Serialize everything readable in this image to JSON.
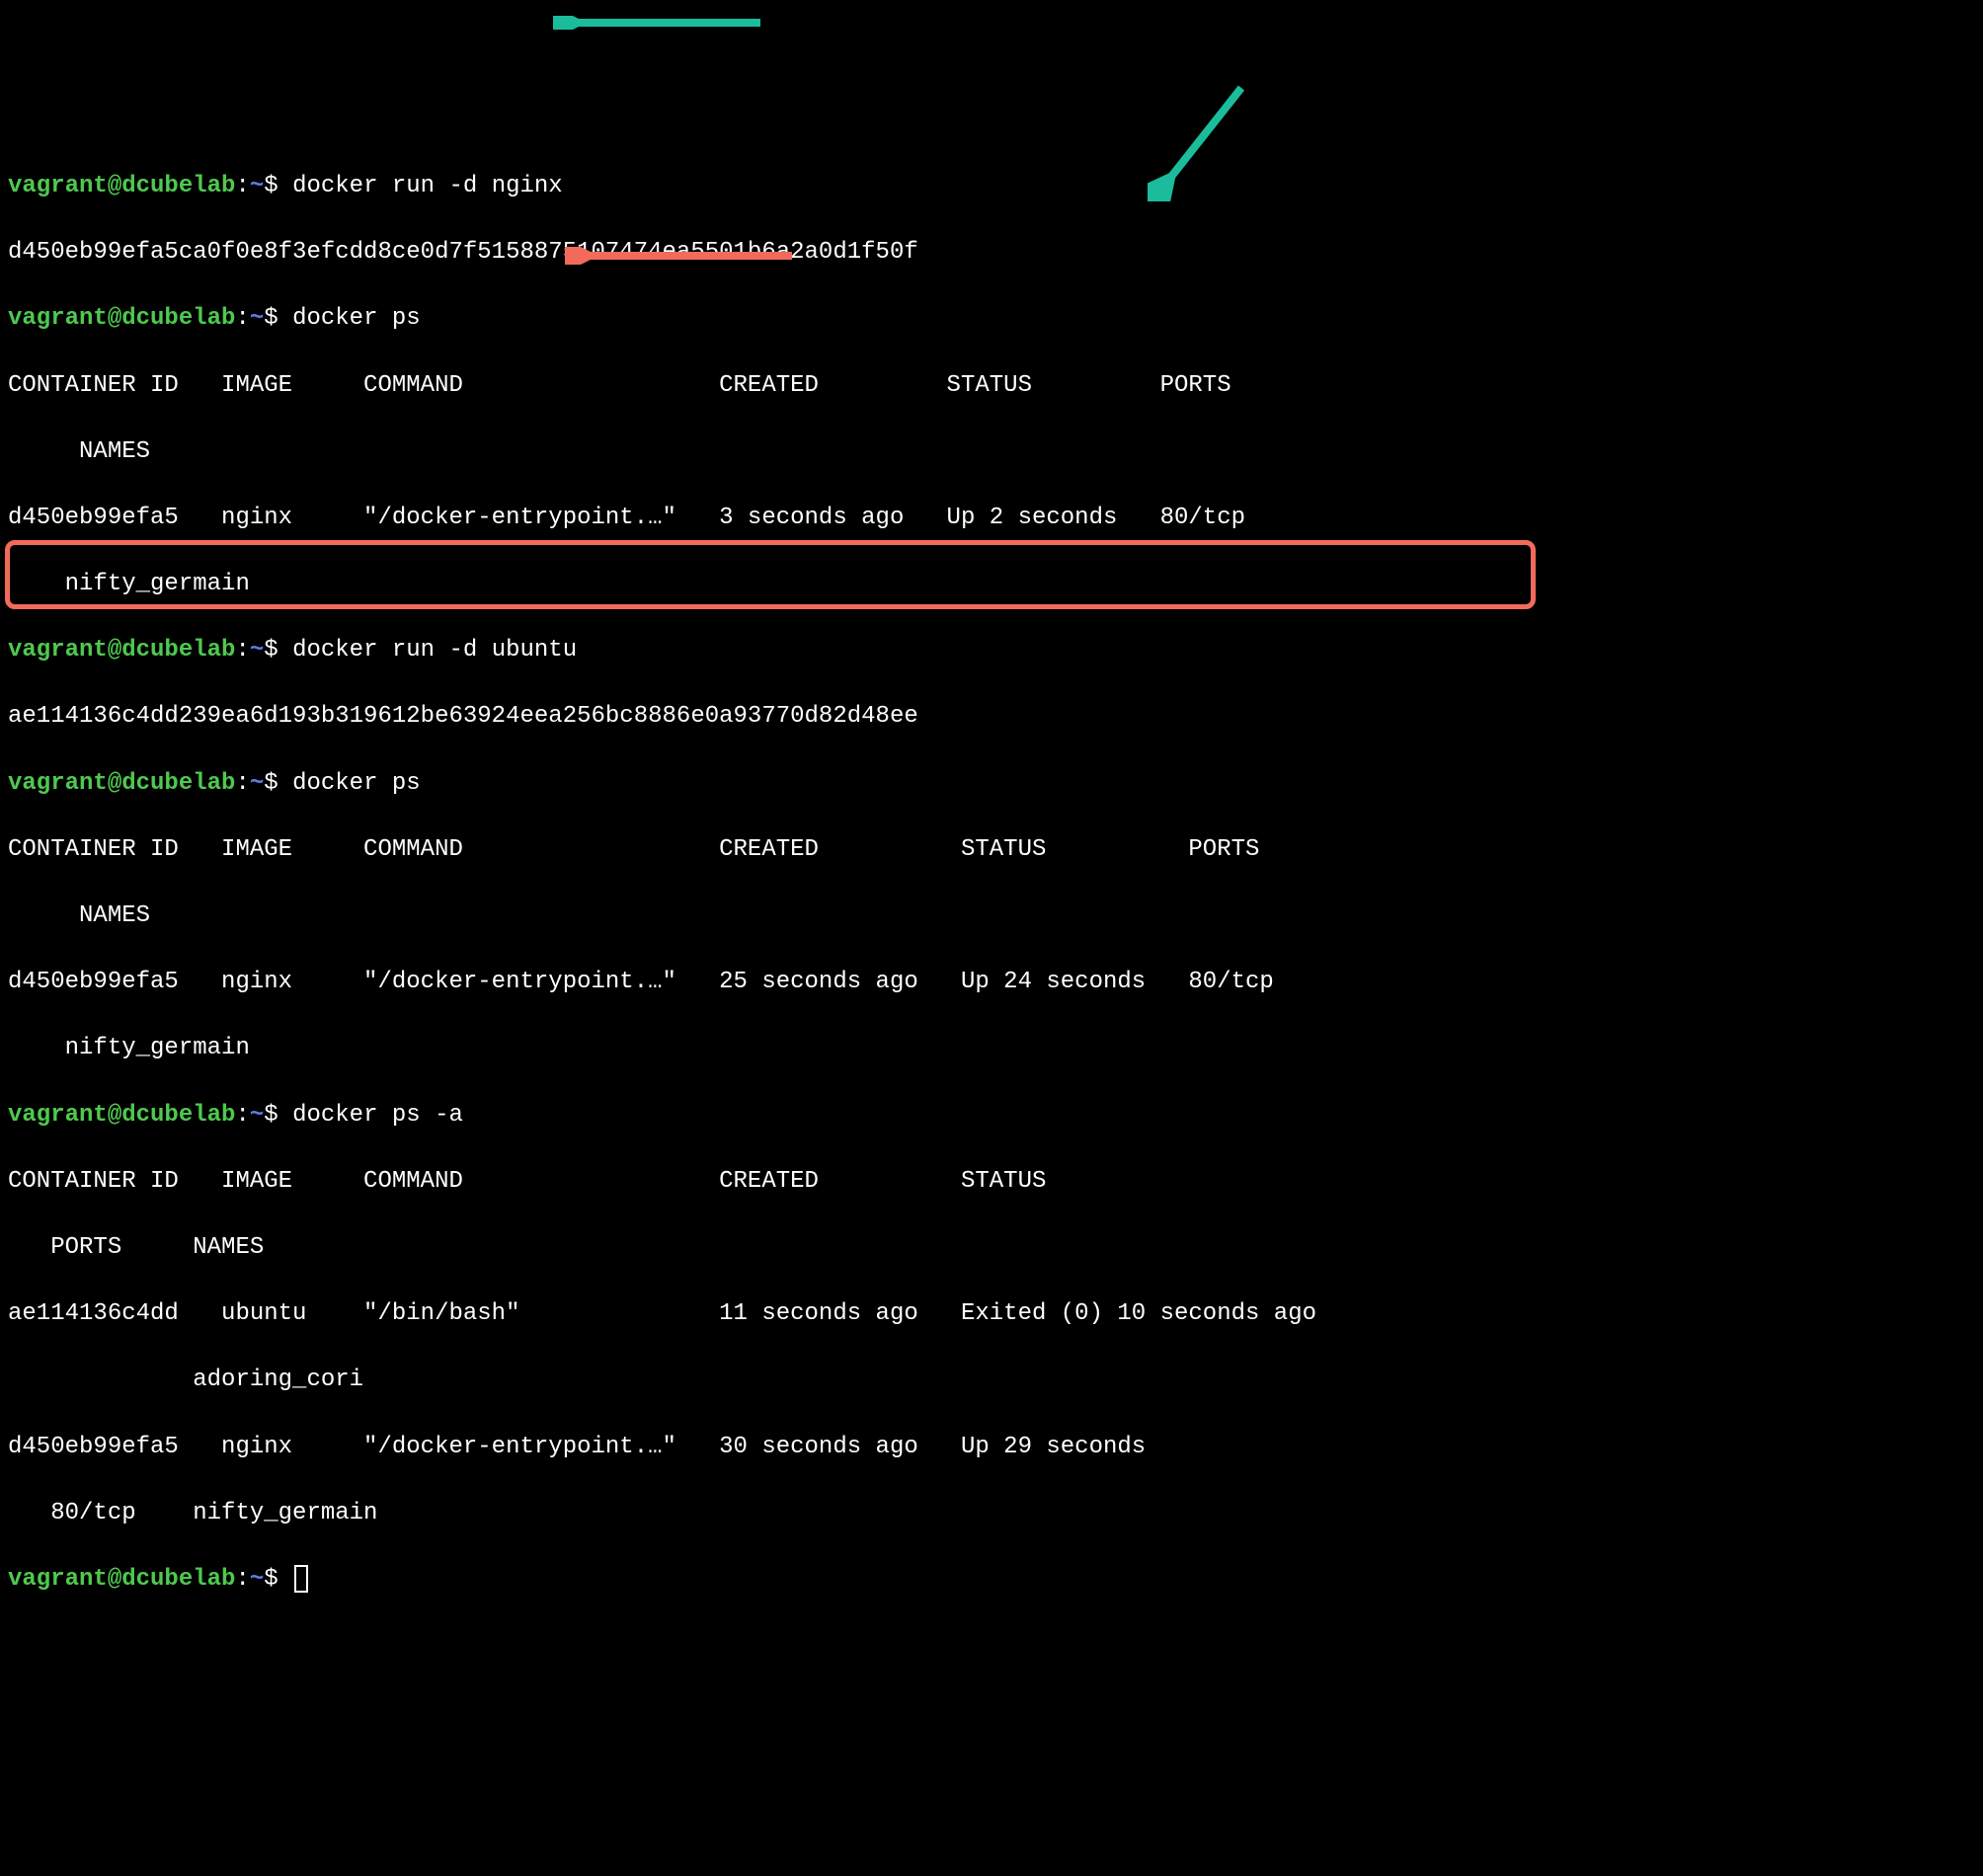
{
  "prompt": {
    "user": "vagrant@dcubelab",
    "colon": ":",
    "path": "~",
    "dollar": "$"
  },
  "cmd1": "docker run -d nginx",
  "out1": "d450eb99efa5ca0f0e8f3efcdd8ce0d7f5158875107474ea5501b6a2a0d1f50f",
  "cmd2": "docker ps",
  "ps1": {
    "hdr1": "CONTAINER ID   IMAGE     COMMAND                  CREATED         STATUS         PORTS",
    "hdr2": "     NAMES",
    "row1": "d450eb99efa5   nginx     \"/docker-entrypoint.…\"   3 seconds ago   Up 2 seconds   80/tcp",
    "row2": "    nifty_germain"
  },
  "cmd3": "docker run -d ubuntu",
  "out3": "ae114136c4dd239ea6d193b319612be63924eea256bc8886e0a93770d82d48ee",
  "cmd4": "docker ps",
  "ps2": {
    "hdr1": "CONTAINER ID   IMAGE     COMMAND                  CREATED          STATUS          PORTS",
    "hdr2": "     NAMES",
    "row1": "d450eb99efa5   nginx     \"/docker-entrypoint.…\"   25 seconds ago   Up 24 seconds   80/tcp",
    "row2": "    nifty_germain"
  },
  "cmd5": "docker ps -a",
  "ps3": {
    "hdr1": "CONTAINER ID   IMAGE     COMMAND                  CREATED          STATUS",
    "hdr2": "   PORTS     NAMES",
    "row1": "ae114136c4dd   ubuntu    \"/bin/bash\"              11 seconds ago   Exited (0) 10 seconds ago",
    "row2": "             adoring_cori",
    "row3": "d450eb99efa5   nginx     \"/docker-entrypoint.…\"   30 seconds ago   Up 29 seconds",
    "row4": "   80/tcp    nifty_germain"
  },
  "colors": {
    "teal": "#1ABC9C",
    "red": "#F26B5A"
  }
}
